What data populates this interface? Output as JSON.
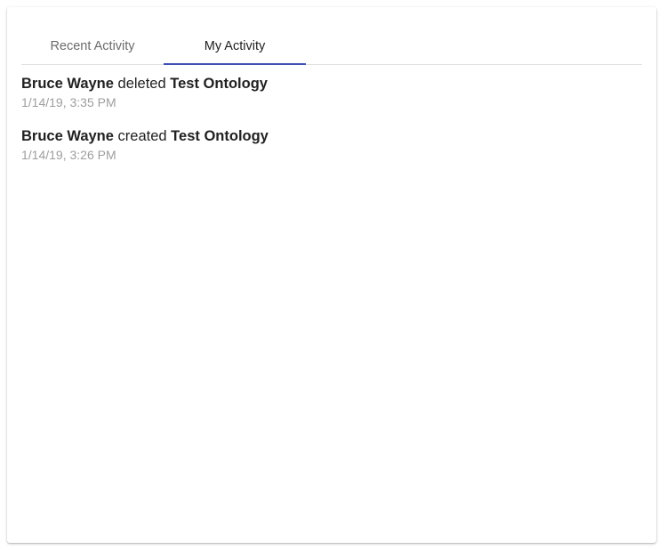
{
  "tabs": [
    {
      "label": "Recent Activity",
      "active": false
    },
    {
      "label": "My Activity",
      "active": true
    }
  ],
  "colors": {
    "tab_indicator": "#3f51b5",
    "text_primary": "#212121",
    "text_secondary": "#9e9e9e"
  },
  "activities": [
    {
      "user": "Bruce Wayne",
      "action": "deleted",
      "target": "Test Ontology",
      "time": "1/14/19, 3:35 PM"
    },
    {
      "user": "Bruce Wayne",
      "action": "created",
      "target": "Test Ontology",
      "time": "1/14/19, 3:26 PM"
    }
  ]
}
